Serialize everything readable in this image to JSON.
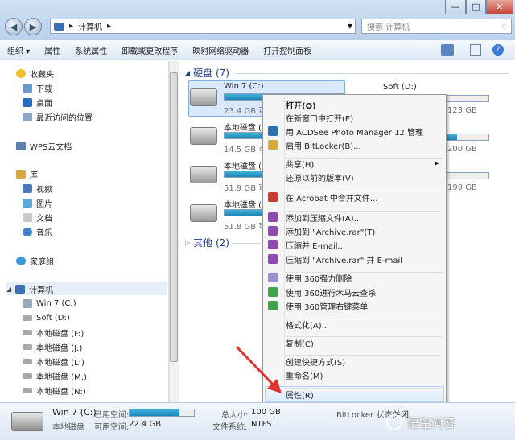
{
  "window": {
    "min": "—",
    "max": "□",
    "close": "✕"
  },
  "address": {
    "path": "计算机",
    "arrow": "▸"
  },
  "search": {
    "placeholder": "搜索 计算机"
  },
  "toolbar": {
    "items": [
      "组织 ▾",
      "属性",
      "系统属性",
      "卸载或更改程序",
      "映射网络驱动器",
      "打开控制面板"
    ]
  },
  "nav": {
    "favorites": "收藏夹",
    "downloads": "下载",
    "desktop": "桌面",
    "recent": "最近访问的位置",
    "wps": "WPS云文档",
    "library": "库",
    "videos": "视频",
    "pictures": "图片",
    "documents": "文档",
    "music": "音乐",
    "homegroup": "家庭组",
    "computer": "计算机",
    "drives": [
      "Win 7 (C:)",
      "Soft (D:)",
      "本地磁盘 (F:)",
      "本地磁盘 (J:)",
      "本地磁盘 (L:)",
      "本地磁盘 (M:)",
      "本地磁盘 (N:)"
    ]
  },
  "content": {
    "hdd_group": "硬盘 (7)",
    "other_group": "其他 (2)",
    "drives": [
      {
        "name": "Win 7 (C:)",
        "size": "23.4 GB 可",
        "fill": 0.78
      },
      {
        "name": "本地磁盘 (",
        "size": "14.5 GB 可",
        "fill": 0.85
      },
      {
        "name": "本地磁盘 (",
        "size": "51.9 GB 可",
        "fill": 0.5
      },
      {
        "name": "本地磁盘 (",
        "size": "51.8 GB 可",
        "fill": 0.5
      }
    ],
    "drives_right": [
      {
        "name": "Soft (D:)",
        "size": "123 GB",
        "fill": 0.6
      },
      {
        "name": "",
        "size": "200 GB",
        "fill": 0.7
      },
      {
        "name": "",
        "size": "199 GB",
        "fill": 0.55
      }
    ]
  },
  "menu": {
    "items": [
      "打开(O)",
      "在新窗口中打开(E)",
      "用 ACDSee Photo Manager 12 管理",
      "启用 BitLocker(B)...",
      "共享(H)",
      "还原以前的版本(V)",
      "在 Acrobat 中合并文件...",
      "添加到压缩文件(A)...",
      "添加到 \"Archive.rar\"(T)",
      "压缩并 E-mail...",
      "压缩到 \"Archive.rar\" 并 E-mail",
      "使用 360强力删除",
      "使用 360进行木马云查杀",
      "使用 360管理右键菜单",
      "格式化(A)...",
      "复制(C)",
      "创建快捷方式(S)",
      "重命名(M)",
      "属性(R)"
    ],
    "submenu_arrow": "▸"
  },
  "status": {
    "drive": "Win 7 (C:)",
    "type": "本地磁盘",
    "used_label": "已用空间:",
    "free_label": "可用空间:",
    "free": "22.4 GB",
    "total_label": "总大小:",
    "total": "100 GB",
    "fs_label": "文件系统:",
    "fs": "NTFS",
    "bitlocker_label": "BitLocker 状态:",
    "bitlocker": "关闭",
    "used_fill": 0.78
  },
  "watermark": "悟空问答",
  "colors": {
    "accent": "#1e3f8c",
    "bar": "#1d86b8",
    "arrow": "#e03030"
  }
}
